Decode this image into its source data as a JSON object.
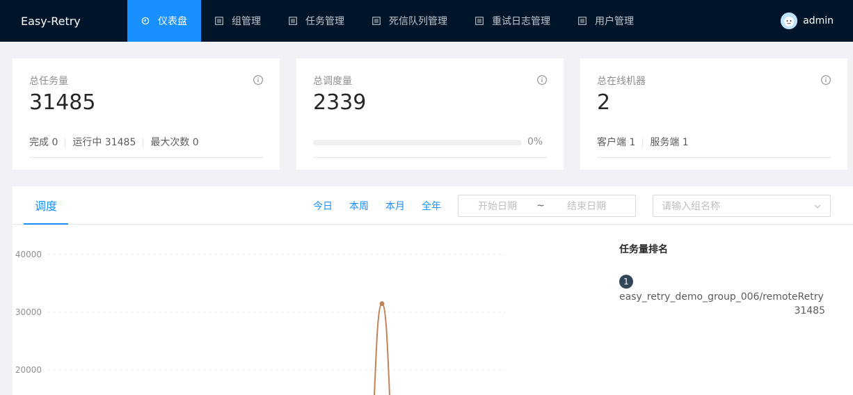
{
  "app": {
    "logo": "Easy-Retry"
  },
  "nav": {
    "items": [
      {
        "label": "仪表盘",
        "icon": "dashboard-icon",
        "active": true
      },
      {
        "label": "组管理",
        "icon": "list-icon",
        "active": false
      },
      {
        "label": "任务管理",
        "icon": "list-icon",
        "active": false
      },
      {
        "label": "死信队列管理",
        "icon": "list-icon",
        "active": false
      },
      {
        "label": "重试日志管理",
        "icon": "list-icon",
        "active": false
      },
      {
        "label": "用户管理",
        "icon": "list-icon",
        "active": false
      }
    ]
  },
  "user": {
    "name": "admin"
  },
  "cards": {
    "total_tasks": {
      "title": "总任务量",
      "value": "31485",
      "stats": [
        "完成 0",
        "运行中 31485",
        "最大次数 0"
      ]
    },
    "total_dispatch": {
      "title": "总调度量",
      "value": "2339",
      "progress": 0,
      "progress_label": "0%"
    },
    "online_machines": {
      "title": "总在线机器",
      "value": "2",
      "stats": [
        "客户端 1",
        "服务端 1"
      ]
    }
  },
  "panel": {
    "tab": "调度",
    "ranges": [
      "今日",
      "本周",
      "本月",
      "全年"
    ],
    "date_start_placeholder": "开始日期",
    "date_separator": "~",
    "date_end_placeholder": "结束日期",
    "group_placeholder": "请输入组名称"
  },
  "ranking": {
    "title": "任务量排名",
    "items": [
      {
        "rank": "1",
        "name": "easy_retry_demo_group_006/remoteRetry",
        "count": "31485"
      }
    ]
  },
  "chart_data": {
    "type": "line",
    "yticks": [
      "40000",
      "30000",
      "20000"
    ],
    "ylim_visible": [
      15000,
      40000
    ],
    "peak_value": 31485,
    "line_color": "#c0845b"
  }
}
